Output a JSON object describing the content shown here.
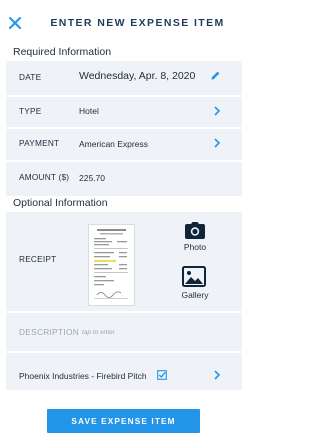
{
  "header": {
    "title": "ENTER NEW EXPENSE ITEM"
  },
  "required": {
    "heading": "Required Information",
    "date_label": "DATE",
    "date_value": "Wednesday, Apr. 8, 2020",
    "type_label": "TYPE",
    "type_value": "Hotel",
    "payment_label": "PAYMENT",
    "payment_value": "American Express",
    "amount_label": "AMOUNT ($)",
    "amount_value": "225.70"
  },
  "optional": {
    "heading": "Optional Information",
    "receipt_label": "RECEIPT",
    "photo_label": "Photo",
    "gallery_label": "Gallery",
    "description_label": "DESCRIPTION",
    "description_placeholder": "tap to enter",
    "project_label": "Phoenix Industries - Firebird Pitch",
    "project_checked": true
  },
  "actions": {
    "save_label": "SAVE EXPENSE ITEM"
  },
  "colors": {
    "accent": "#2395e8",
    "panel_bg": "#eff3f8",
    "title_color": "#1f3b5a"
  },
  "icons": {
    "close": "close-icon",
    "edit": "pencil-icon",
    "chevron": "chevron-right-icon",
    "camera": "camera-icon",
    "gallery": "image-icon",
    "checkbox": "checkbox-checked-icon"
  }
}
